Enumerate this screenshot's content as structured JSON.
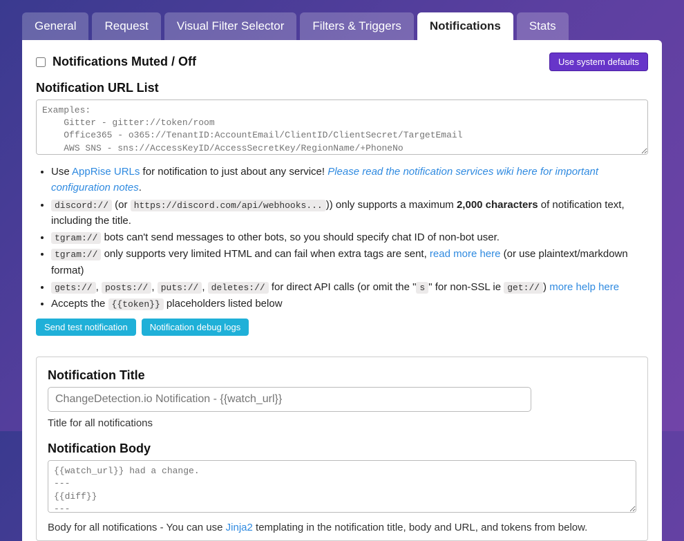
{
  "tabs": {
    "general": "General",
    "request": "Request",
    "vfs": "Visual Filter Selector",
    "filters": "Filters & Triggers",
    "notifications": "Notifications",
    "stats": "Stats"
  },
  "top": {
    "muted_label": "Notifications Muted / Off",
    "defaults_btn": "Use system defaults"
  },
  "url_list": {
    "label": "Notification URL List",
    "placeholder": "Examples:\n    Gitter - gitter://token/room\n    Office365 - o365://TenantID:AccountEmail/ClientID/ClientSecret/TargetEmail\n    AWS SNS - sns://AccessKeyID/AccessSecretKey/RegionName/+PhoneNo\n    SMTPS - mailtos://user:pass@mail.domain.com?to=receivingAddress@example.com"
  },
  "notes": {
    "li1_pre": "Use ",
    "li1_link": "AppRise URLs",
    "li1_mid": " for notification to just about any service! ",
    "li1_link2": "Please read the notification services wiki here for important configuration notes",
    "li1_end": ".",
    "li2_code1": "discord://",
    "li2_a": " (or ",
    "li2_code2": "https://discord.com/api/webhooks...",
    "li2_b": ")) only supports a maximum ",
    "li2_bold": "2,000 characters",
    "li2_c": " of notification text, including the title.",
    "li3_code": "tgram://",
    "li3_txt": " bots can't send messages to other bots, so you should specify chat ID of non-bot user.",
    "li4_code": "tgram://",
    "li4_a": " only supports very limited HTML and can fail when extra tags are sent, ",
    "li4_link": "read more here",
    "li4_b": " (or use plaintext/markdown format)",
    "li5_c1": "gets://",
    "li5_s1": ", ",
    "li5_c2": "posts://",
    "li5_s2": ", ",
    "li5_c3": "puts://",
    "li5_s3": ", ",
    "li5_c4": "deletes://",
    "li5_mid": " for direct API calls (or omit the \"",
    "li5_c5": "s",
    "li5_mid2": "\" for non-SSL ie ",
    "li5_c6": "get://",
    "li5_end": ") ",
    "li5_link": "more help here",
    "li6_a": "Accepts the ",
    "li6_code": "{{token}}",
    "li6_b": " placeholders listed below"
  },
  "actions": {
    "send_test": "Send test notification",
    "debug_logs": "Notification debug logs"
  },
  "title_section": {
    "label": "Notification Title",
    "placeholder": "ChangeDetection.io Notification - {{watch_url}}",
    "help": "Title for all notifications"
  },
  "body_section": {
    "label": "Notification Body",
    "placeholder": "{{watch_url}} had a change.\n---\n{{diff}}\n---",
    "help_pre": "Body for all notifications ‐ You can use ",
    "help_link": "Jinja2",
    "help_post": " templating in the notification title, body and URL, and tokens from below."
  }
}
